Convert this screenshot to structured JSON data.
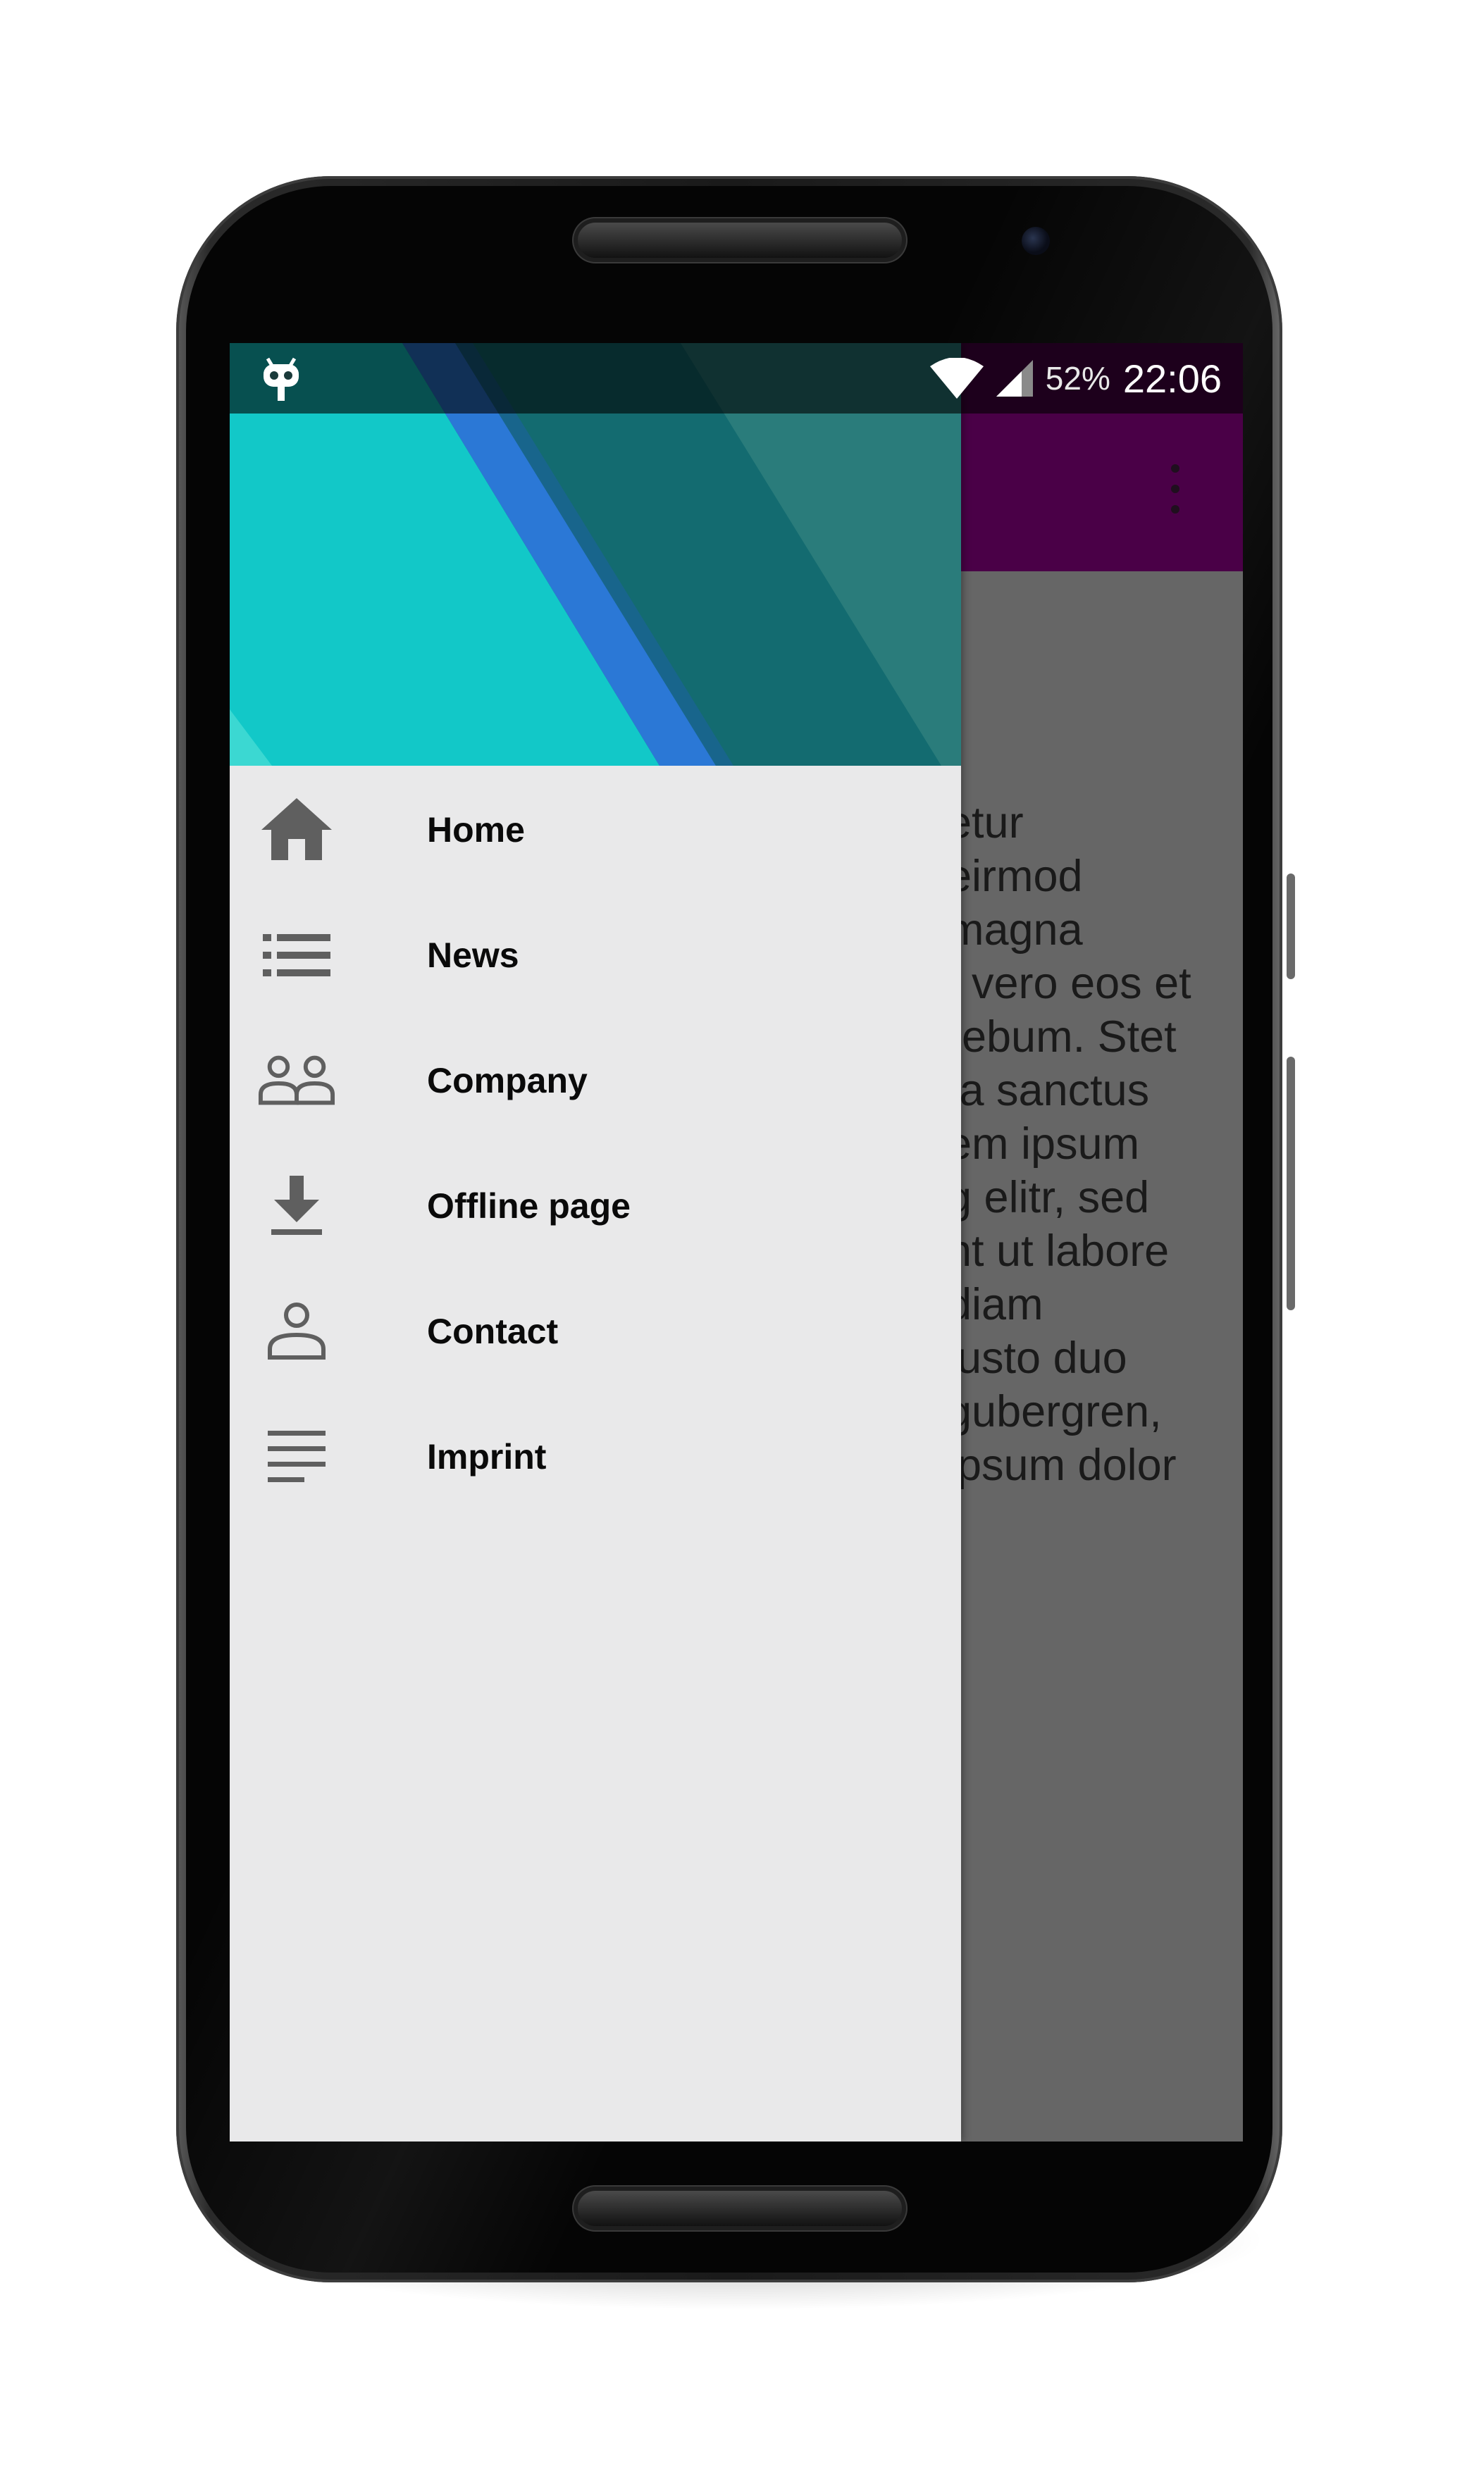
{
  "status_bar": {
    "battery": "52%",
    "time": "22:06",
    "notification_icon": "cyanogenmod-bot-icon",
    "wifi_icon": "wifi-icon",
    "signal_icon": "signal-icon"
  },
  "app": {
    "toolbar_color": "#4a0047",
    "content_lines": [
      "etur",
      "eirmod",
      "magna",
      "t vero eos et",
      "rebum. Stet",
      "ta sanctus",
      "em ipsum",
      "g elitr, sed",
      "nt ut labore",
      "diam",
      "justo duo",
      "gubergren,",
      "ipsum dolor"
    ]
  },
  "drawer": {
    "background": "#e9e9ea",
    "items": [
      {
        "label": "Home",
        "icon": "home-icon"
      },
      {
        "label": "News",
        "icon": "list-icon"
      },
      {
        "label": "Company",
        "icon": "people-icon"
      },
      {
        "label": "Offline page",
        "icon": "download-icon"
      },
      {
        "label": "Contact",
        "icon": "person-icon"
      },
      {
        "label": "Imprint",
        "icon": "text-lines-icon"
      }
    ]
  },
  "colors": {
    "header_teal": "#12c8c8",
    "header_dark_teal": "#136b70",
    "header_blue_stripe": "#2b78d6",
    "icon_gray": "#616161"
  }
}
